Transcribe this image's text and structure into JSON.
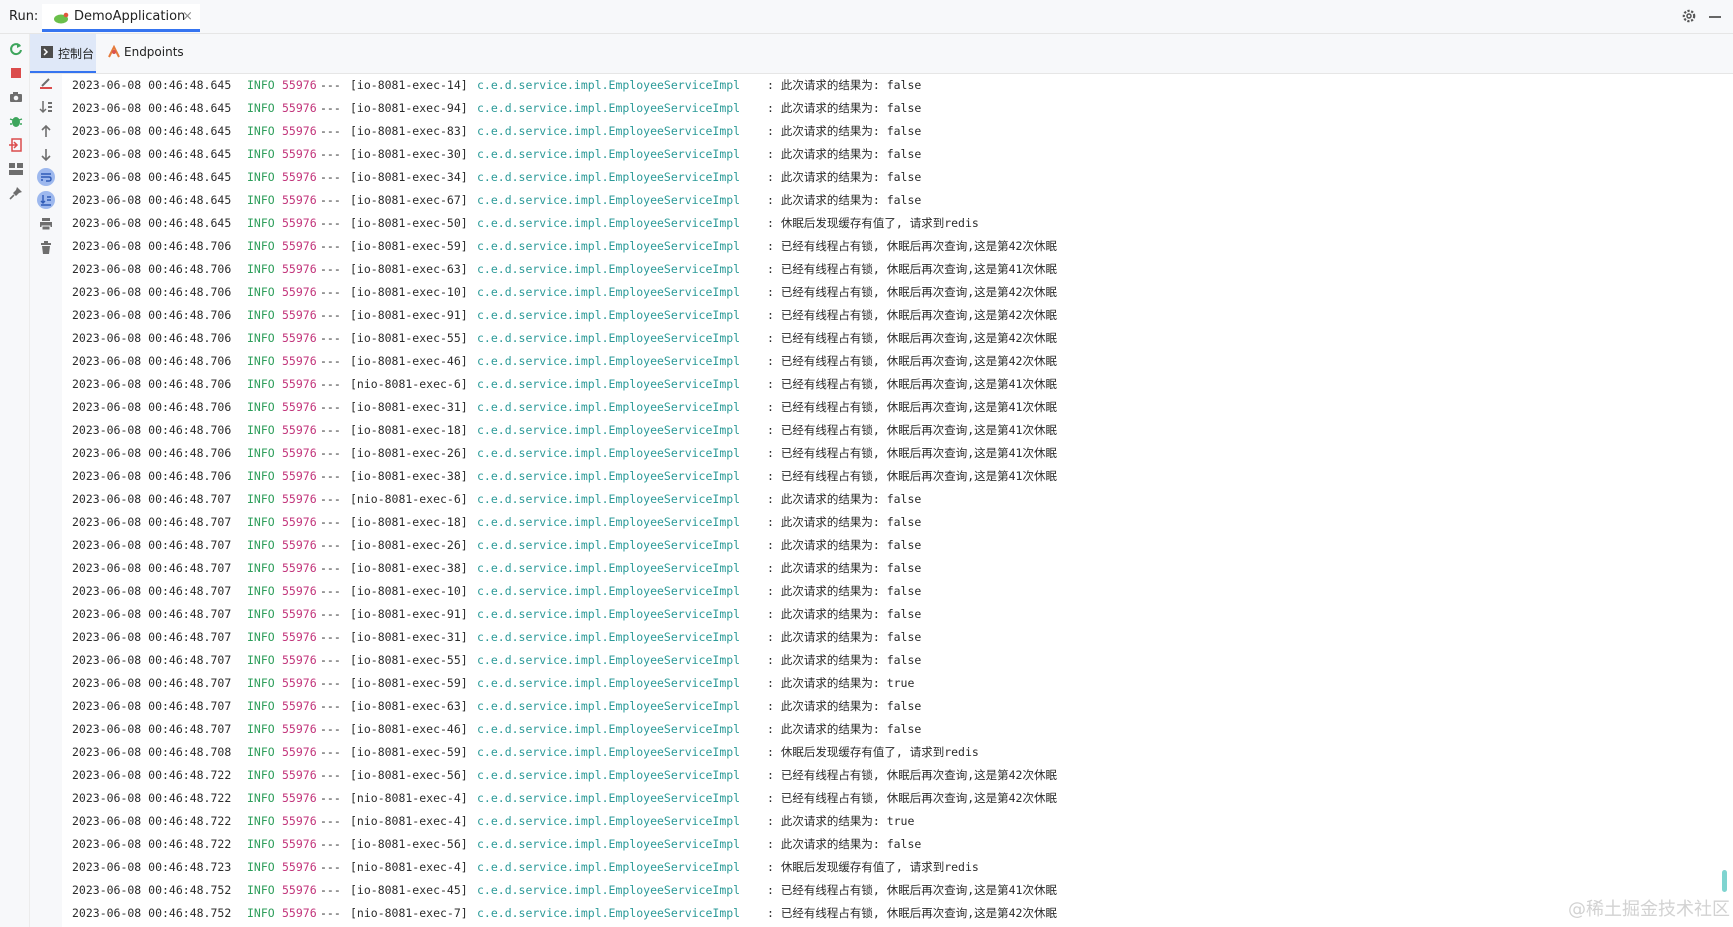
{
  "header": {
    "run_label": "Run:",
    "tab_title": "DemoApplication",
    "close_glyph": "×",
    "icons": {
      "app": "spring-leaf-icon",
      "settings": "gear-icon",
      "minimize": "minimize-icon"
    }
  },
  "toolwindow": {
    "icons": [
      "rerun-icon",
      "stop-icon",
      "camera-icon",
      "debug-icon",
      "exit-icon",
      "layout-icon",
      "pin-icon"
    ]
  },
  "tabs": [
    {
      "label": "控制台",
      "icon": "console-icon",
      "active": true
    },
    {
      "label": "Endpoints",
      "icon": "endpoints-icon",
      "active": false
    }
  ],
  "gutter": {
    "icons": [
      "clear-icon",
      "sort-icon",
      "up-arrow-icon",
      "down-arrow-icon",
      "soft-wrap-icon",
      "scroll-to-end-icon",
      "print-icon",
      "trash-icon"
    ]
  },
  "log": {
    "lines": [
      {
        "ts": "2023-06-08 00:46:48.645",
        "level": "INFO",
        "pid": "55976",
        "sep": "---",
        "thread": "[io-8081-exec-14]",
        "cls": "c.e.d.service.impl.EmployeeServiceImpl",
        "msg": ": 此次请求的结果为: false"
      },
      {
        "ts": "2023-06-08 00:46:48.645",
        "level": "INFO",
        "pid": "55976",
        "sep": "---",
        "thread": "[io-8081-exec-94]",
        "cls": "c.e.d.service.impl.EmployeeServiceImpl",
        "msg": ": 此次请求的结果为: false"
      },
      {
        "ts": "2023-06-08 00:46:48.645",
        "level": "INFO",
        "pid": "55976",
        "sep": "---",
        "thread": "[io-8081-exec-83]",
        "cls": "c.e.d.service.impl.EmployeeServiceImpl",
        "msg": ": 此次请求的结果为: false"
      },
      {
        "ts": "2023-06-08 00:46:48.645",
        "level": "INFO",
        "pid": "55976",
        "sep": "---",
        "thread": "[io-8081-exec-30]",
        "cls": "c.e.d.service.impl.EmployeeServiceImpl",
        "msg": ": 此次请求的结果为: false"
      },
      {
        "ts": "2023-06-08 00:46:48.645",
        "level": "INFO",
        "pid": "55976",
        "sep": "---",
        "thread": "[io-8081-exec-34]",
        "cls": "c.e.d.service.impl.EmployeeServiceImpl",
        "msg": ": 此次请求的结果为: false"
      },
      {
        "ts": "2023-06-08 00:46:48.645",
        "level": "INFO",
        "pid": "55976",
        "sep": "---",
        "thread": "[io-8081-exec-67]",
        "cls": "c.e.d.service.impl.EmployeeServiceImpl",
        "msg": ": 此次请求的结果为: false"
      },
      {
        "ts": "2023-06-08 00:46:48.645",
        "level": "INFO",
        "pid": "55976",
        "sep": "---",
        "thread": "[io-8081-exec-50]",
        "cls": "c.e.d.service.impl.EmployeeServiceImpl",
        "msg": ": 休眠后发现缓存有值了, 请求到redis"
      },
      {
        "ts": "2023-06-08 00:46:48.706",
        "level": "INFO",
        "pid": "55976",
        "sep": "---",
        "thread": "[io-8081-exec-59]",
        "cls": "c.e.d.service.impl.EmployeeServiceImpl",
        "msg": ": 已经有线程占有锁, 休眠后再次查询,这是第42次休眠"
      },
      {
        "ts": "2023-06-08 00:46:48.706",
        "level": "INFO",
        "pid": "55976",
        "sep": "---",
        "thread": "[io-8081-exec-63]",
        "cls": "c.e.d.service.impl.EmployeeServiceImpl",
        "msg": ": 已经有线程占有锁, 休眠后再次查询,这是第41次休眠"
      },
      {
        "ts": "2023-06-08 00:46:48.706",
        "level": "INFO",
        "pid": "55976",
        "sep": "---",
        "thread": "[io-8081-exec-10]",
        "cls": "c.e.d.service.impl.EmployeeServiceImpl",
        "msg": ": 已经有线程占有锁, 休眠后再次查询,这是第42次休眠"
      },
      {
        "ts": "2023-06-08 00:46:48.706",
        "level": "INFO",
        "pid": "55976",
        "sep": "---",
        "thread": "[io-8081-exec-91]",
        "cls": "c.e.d.service.impl.EmployeeServiceImpl",
        "msg": ": 已经有线程占有锁, 休眠后再次查询,这是第42次休眠"
      },
      {
        "ts": "2023-06-08 00:46:48.706",
        "level": "INFO",
        "pid": "55976",
        "sep": "---",
        "thread": "[io-8081-exec-55]",
        "cls": "c.e.d.service.impl.EmployeeServiceImpl",
        "msg": ": 已经有线程占有锁, 休眠后再次查询,这是第42次休眠"
      },
      {
        "ts": "2023-06-08 00:46:48.706",
        "level": "INFO",
        "pid": "55976",
        "sep": "---",
        "thread": "[io-8081-exec-46]",
        "cls": "c.e.d.service.impl.EmployeeServiceImpl",
        "msg": ": 已经有线程占有锁, 休眠后再次查询,这是第42次休眠"
      },
      {
        "ts": "2023-06-08 00:46:48.706",
        "level": "INFO",
        "pid": "55976",
        "sep": "---",
        "thread": "[nio-8081-exec-6]",
        "cls": "c.e.d.service.impl.EmployeeServiceImpl",
        "msg": ": 已经有线程占有锁, 休眠后再次查询,这是第41次休眠"
      },
      {
        "ts": "2023-06-08 00:46:48.706",
        "level": "INFO",
        "pid": "55976",
        "sep": "---",
        "thread": "[io-8081-exec-31]",
        "cls": "c.e.d.service.impl.EmployeeServiceImpl",
        "msg": ": 已经有线程占有锁, 休眠后再次查询,这是第41次休眠"
      },
      {
        "ts": "2023-06-08 00:46:48.706",
        "level": "INFO",
        "pid": "55976",
        "sep": "---",
        "thread": "[io-8081-exec-18]",
        "cls": "c.e.d.service.impl.EmployeeServiceImpl",
        "msg": ": 已经有线程占有锁, 休眠后再次查询,这是第41次休眠"
      },
      {
        "ts": "2023-06-08 00:46:48.706",
        "level": "INFO",
        "pid": "55976",
        "sep": "---",
        "thread": "[io-8081-exec-26]",
        "cls": "c.e.d.service.impl.EmployeeServiceImpl",
        "msg": ": 已经有线程占有锁, 休眠后再次查询,这是第41次休眠"
      },
      {
        "ts": "2023-06-08 00:46:48.706",
        "level": "INFO",
        "pid": "55976",
        "sep": "---",
        "thread": "[io-8081-exec-38]",
        "cls": "c.e.d.service.impl.EmployeeServiceImpl",
        "msg": ": 已经有线程占有锁, 休眠后再次查询,这是第41次休眠"
      },
      {
        "ts": "2023-06-08 00:46:48.707",
        "level": "INFO",
        "pid": "55976",
        "sep": "---",
        "thread": "[nio-8081-exec-6]",
        "cls": "c.e.d.service.impl.EmployeeServiceImpl",
        "msg": ": 此次请求的结果为: false"
      },
      {
        "ts": "2023-06-08 00:46:48.707",
        "level": "INFO",
        "pid": "55976",
        "sep": "---",
        "thread": "[io-8081-exec-18]",
        "cls": "c.e.d.service.impl.EmployeeServiceImpl",
        "msg": ": 此次请求的结果为: false"
      },
      {
        "ts": "2023-06-08 00:46:48.707",
        "level": "INFO",
        "pid": "55976",
        "sep": "---",
        "thread": "[io-8081-exec-26]",
        "cls": "c.e.d.service.impl.EmployeeServiceImpl",
        "msg": ": 此次请求的结果为: false"
      },
      {
        "ts": "2023-06-08 00:46:48.707",
        "level": "INFO",
        "pid": "55976",
        "sep": "---",
        "thread": "[io-8081-exec-38]",
        "cls": "c.e.d.service.impl.EmployeeServiceImpl",
        "msg": ": 此次请求的结果为: false"
      },
      {
        "ts": "2023-06-08 00:46:48.707",
        "level": "INFO",
        "pid": "55976",
        "sep": "---",
        "thread": "[io-8081-exec-10]",
        "cls": "c.e.d.service.impl.EmployeeServiceImpl",
        "msg": ": 此次请求的结果为: false"
      },
      {
        "ts": "2023-06-08 00:46:48.707",
        "level": "INFO",
        "pid": "55976",
        "sep": "---",
        "thread": "[io-8081-exec-91]",
        "cls": "c.e.d.service.impl.EmployeeServiceImpl",
        "msg": ": 此次请求的结果为: false"
      },
      {
        "ts": "2023-06-08 00:46:48.707",
        "level": "INFO",
        "pid": "55976",
        "sep": "---",
        "thread": "[io-8081-exec-31]",
        "cls": "c.e.d.service.impl.EmployeeServiceImpl",
        "msg": ": 此次请求的结果为: false"
      },
      {
        "ts": "2023-06-08 00:46:48.707",
        "level": "INFO",
        "pid": "55976",
        "sep": "---",
        "thread": "[io-8081-exec-55]",
        "cls": "c.e.d.service.impl.EmployeeServiceImpl",
        "msg": ": 此次请求的结果为: false"
      },
      {
        "ts": "2023-06-08 00:46:48.707",
        "level": "INFO",
        "pid": "55976",
        "sep": "---",
        "thread": "[io-8081-exec-59]",
        "cls": "c.e.d.service.impl.EmployeeServiceImpl",
        "msg": ": 此次请求的结果为: true"
      },
      {
        "ts": "2023-06-08 00:46:48.707",
        "level": "INFO",
        "pid": "55976",
        "sep": "---",
        "thread": "[io-8081-exec-63]",
        "cls": "c.e.d.service.impl.EmployeeServiceImpl",
        "msg": ": 此次请求的结果为: false"
      },
      {
        "ts": "2023-06-08 00:46:48.707",
        "level": "INFO",
        "pid": "55976",
        "sep": "---",
        "thread": "[io-8081-exec-46]",
        "cls": "c.e.d.service.impl.EmployeeServiceImpl",
        "msg": ": 此次请求的结果为: false"
      },
      {
        "ts": "2023-06-08 00:46:48.708",
        "level": "INFO",
        "pid": "55976",
        "sep": "---",
        "thread": "[io-8081-exec-59]",
        "cls": "c.e.d.service.impl.EmployeeServiceImpl",
        "msg": ": 休眠后发现缓存有值了, 请求到redis"
      },
      {
        "ts": "2023-06-08 00:46:48.722",
        "level": "INFO",
        "pid": "55976",
        "sep": "---",
        "thread": "[io-8081-exec-56]",
        "cls": "c.e.d.service.impl.EmployeeServiceImpl",
        "msg": ": 已经有线程占有锁, 休眠后再次查询,这是第42次休眠"
      },
      {
        "ts": "2023-06-08 00:46:48.722",
        "level": "INFO",
        "pid": "55976",
        "sep": "---",
        "thread": "[nio-8081-exec-4]",
        "cls": "c.e.d.service.impl.EmployeeServiceImpl",
        "msg": ": 已经有线程占有锁, 休眠后再次查询,这是第42次休眠"
      },
      {
        "ts": "2023-06-08 00:46:48.722",
        "level": "INFO",
        "pid": "55976",
        "sep": "---",
        "thread": "[nio-8081-exec-4]",
        "cls": "c.e.d.service.impl.EmployeeServiceImpl",
        "msg": ": 此次请求的结果为: true"
      },
      {
        "ts": "2023-06-08 00:46:48.722",
        "level": "INFO",
        "pid": "55976",
        "sep": "---",
        "thread": "[io-8081-exec-56]",
        "cls": "c.e.d.service.impl.EmployeeServiceImpl",
        "msg": ": 此次请求的结果为: false"
      },
      {
        "ts": "2023-06-08 00:46:48.723",
        "level": "INFO",
        "pid": "55976",
        "sep": "---",
        "thread": "[nio-8081-exec-4]",
        "cls": "c.e.d.service.impl.EmployeeServiceImpl",
        "msg": ": 休眠后发现缓存有值了, 请求到redis"
      },
      {
        "ts": "2023-06-08 00:46:48.752",
        "level": "INFO",
        "pid": "55976",
        "sep": "---",
        "thread": "[io-8081-exec-45]",
        "cls": "c.e.d.service.impl.EmployeeServiceImpl",
        "msg": ": 已经有线程占有锁, 休眠后再次查询,这是第41次休眠"
      },
      {
        "ts": "2023-06-08 00:46:48.752",
        "level": "INFO",
        "pid": "55976",
        "sep": "---",
        "thread": "[nio-8081-exec-7]",
        "cls": "c.e.d.service.impl.EmployeeServiceImpl",
        "msg": ": 已经有线程占有锁, 休眠后再次查询,这是第42次休眠"
      }
    ]
  },
  "watermark": "@稀土掘金技术社区",
  "colors": {
    "accent": "#3574f0",
    "info": "#2e9e5b",
    "pid": "#c2337a",
    "logger": "#2b9a98",
    "text": "#2b2b2b"
  }
}
